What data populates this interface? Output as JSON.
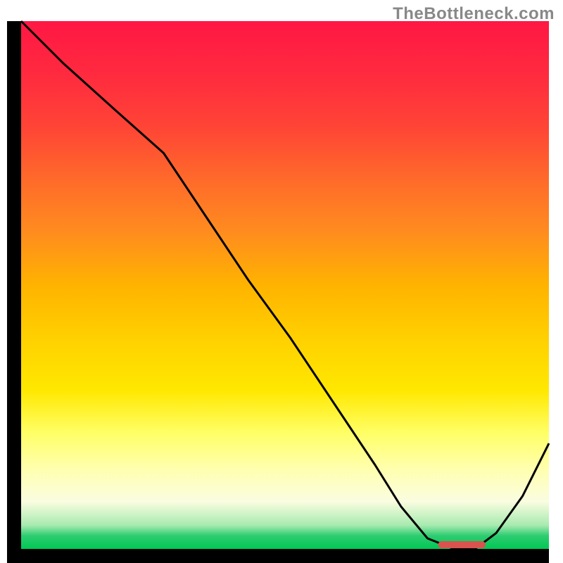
{
  "watermark": "TheBottleneck.com",
  "chart_data": {
    "type": "line",
    "title": "",
    "xlabel": "",
    "ylabel": "",
    "xlim": [
      0,
      100
    ],
    "ylim": [
      0,
      100
    ],
    "background_gradient": {
      "stops": [
        {
          "offset": 0.0,
          "color": "#ff1744"
        },
        {
          "offset": 0.1,
          "color": "#ff2a3f"
        },
        {
          "offset": 0.2,
          "color": "#ff4436"
        },
        {
          "offset": 0.3,
          "color": "#ff6a2a"
        },
        {
          "offset": 0.4,
          "color": "#ff8c1f"
        },
        {
          "offset": 0.5,
          "color": "#ffb300"
        },
        {
          "offset": 0.6,
          "color": "#ffd000"
        },
        {
          "offset": 0.7,
          "color": "#ffe800"
        },
        {
          "offset": 0.78,
          "color": "#ffff66"
        },
        {
          "offset": 0.85,
          "color": "#ffffb0"
        },
        {
          "offset": 0.91,
          "color": "#fafde0"
        },
        {
          "offset": 0.955,
          "color": "#a8eab0"
        },
        {
          "offset": 0.975,
          "color": "#2ecc71"
        },
        {
          "offset": 1.0,
          "color": "#00c853"
        }
      ]
    },
    "series": [
      {
        "name": "bottleneck-curve",
        "color": "#000000",
        "width": 3,
        "x": [
          0,
          8,
          18,
          27,
          35,
          43,
          51,
          59,
          67,
          72,
          77,
          82,
          86,
          90,
          95,
          100
        ],
        "y": [
          100,
          92,
          83,
          75,
          63,
          51,
          40,
          28,
          16,
          8,
          2,
          0,
          0,
          3,
          10,
          20
        ]
      }
    ],
    "marker": {
      "name": "optimal-range",
      "color": "#d9534f",
      "x_start": 79,
      "x_end": 88,
      "y": 0.8,
      "thickness": 10
    },
    "axes": {
      "color": "#000000",
      "width": 20
    }
  }
}
